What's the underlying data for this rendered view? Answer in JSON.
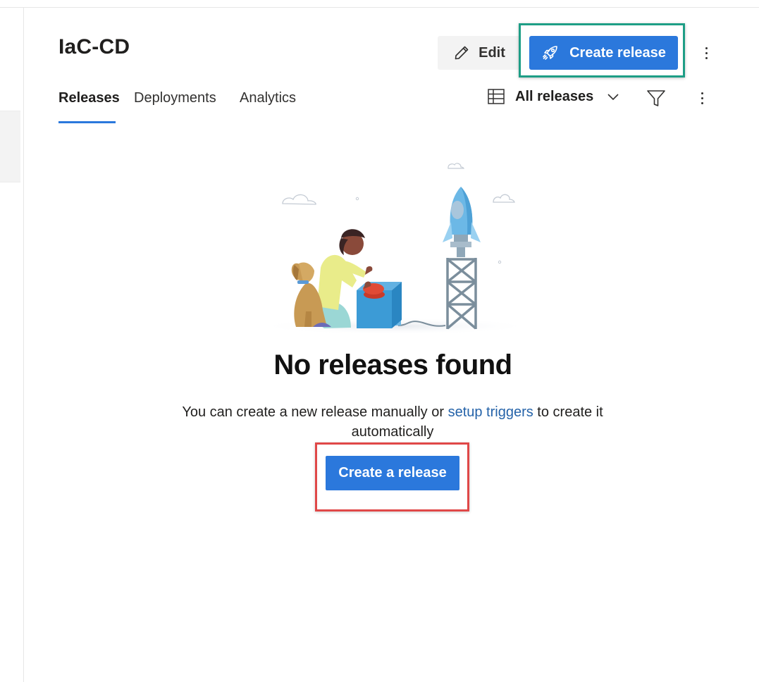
{
  "header": {
    "title": "IaC-CD",
    "edit_label": "Edit",
    "create_release_label": "Create release"
  },
  "tabs": [
    {
      "label": "Releases",
      "active": true
    },
    {
      "label": "Deployments",
      "active": false
    },
    {
      "label": "Analytics",
      "active": false
    }
  ],
  "toolbar": {
    "view_label": "All releases"
  },
  "empty_state": {
    "title": "No releases found",
    "text_before": "You can create a new release manually or ",
    "link_text": "setup triggers",
    "text_after": " to create it automatically",
    "button_label": "Create a release"
  },
  "colors": {
    "primary": "#2b78dc",
    "link": "#2563a9",
    "highlight_green": "#1e9e86",
    "highlight_red": "#e04848"
  },
  "icons": [
    "pencil-icon",
    "rocket-icon",
    "more-vertical-icon",
    "table-icon",
    "chevron-down-icon",
    "filter-icon"
  ]
}
